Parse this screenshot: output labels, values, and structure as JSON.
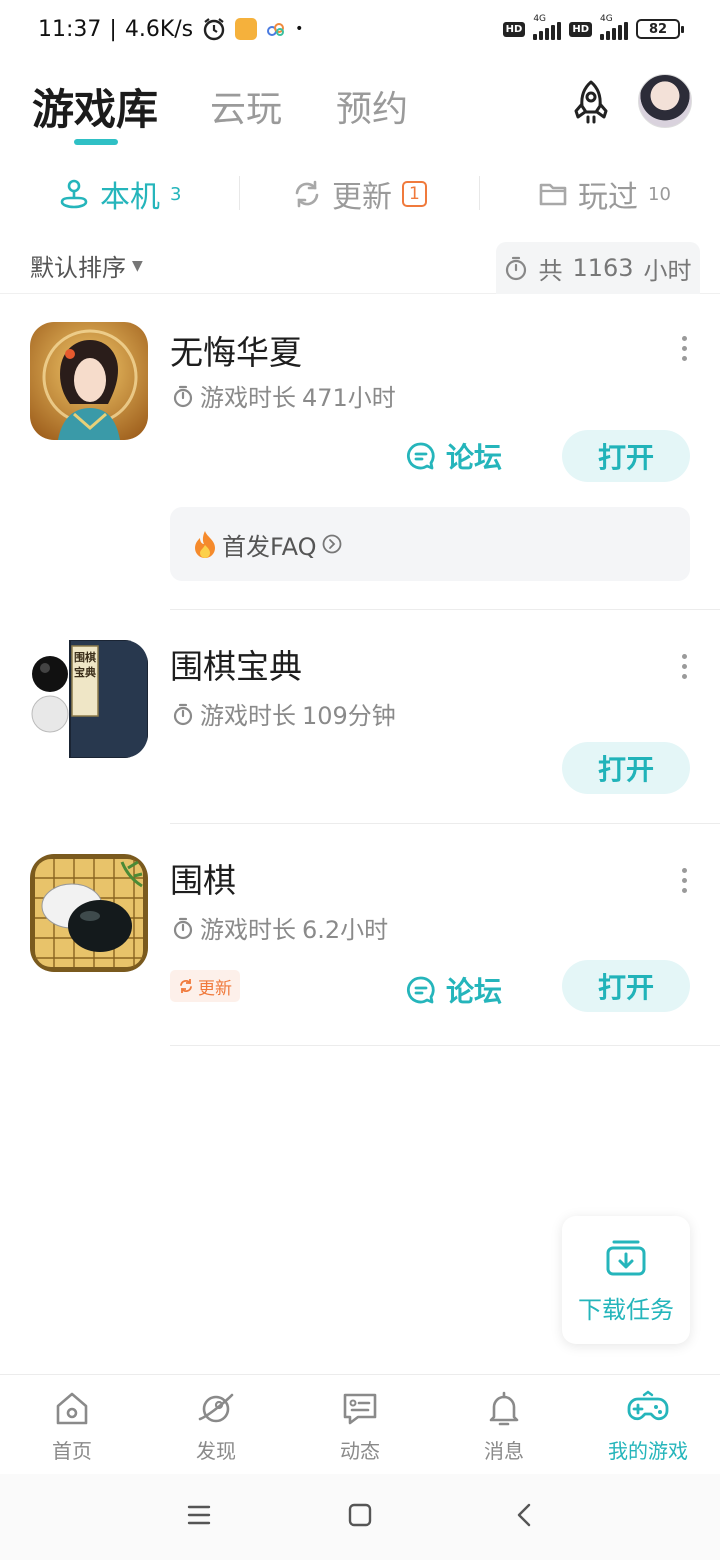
{
  "status_bar": {
    "time": "11:37",
    "network_speed": "4.6K/s",
    "separator": "|",
    "hd1": "HD",
    "net1": "4G",
    "hd2": "HD",
    "net2": "4G",
    "battery": "82",
    "dot": "•"
  },
  "header": {
    "tabs": [
      "游戏库",
      "云玩",
      "预约"
    ],
    "active_tab": "游戏库"
  },
  "subtabs": {
    "local": {
      "label": "本机",
      "count": "3"
    },
    "update": {
      "label": "更新",
      "badge": "1"
    },
    "played": {
      "label": "玩过",
      "count": "10"
    }
  },
  "sort": {
    "label": "默认排序",
    "total_prefix": "共",
    "total_hours": "1163",
    "total_unit": "小时"
  },
  "games": [
    {
      "name": "无悔华夏",
      "time_label": "游戏时长",
      "time_value": "471小时",
      "forum": "论坛",
      "open": "打开",
      "faq": "首发FAQ"
    },
    {
      "name": "围棋宝典",
      "time_label": "游戏时长",
      "time_value": "109分钟",
      "open": "打开"
    },
    {
      "name": "围棋",
      "time_label": "游戏时长",
      "time_value": "6.2小时",
      "forum": "论坛",
      "open": "打开",
      "update_tag": "更新"
    }
  ],
  "icon_text": {
    "book_title": "围棋宝典"
  },
  "fab": {
    "label": "下载任务"
  },
  "bottom_nav": [
    {
      "label": "首页",
      "icon": "home-icon"
    },
    {
      "label": "发现",
      "icon": "planet-icon"
    },
    {
      "label": "动态",
      "icon": "message-board-icon"
    },
    {
      "label": "消息",
      "icon": "bell-icon"
    },
    {
      "label": "我的游戏",
      "icon": "gamepad-icon"
    }
  ],
  "colors": {
    "accent": "#25b5bb",
    "update": "#f07a3c",
    "open_bg": "#e4f6f7"
  }
}
